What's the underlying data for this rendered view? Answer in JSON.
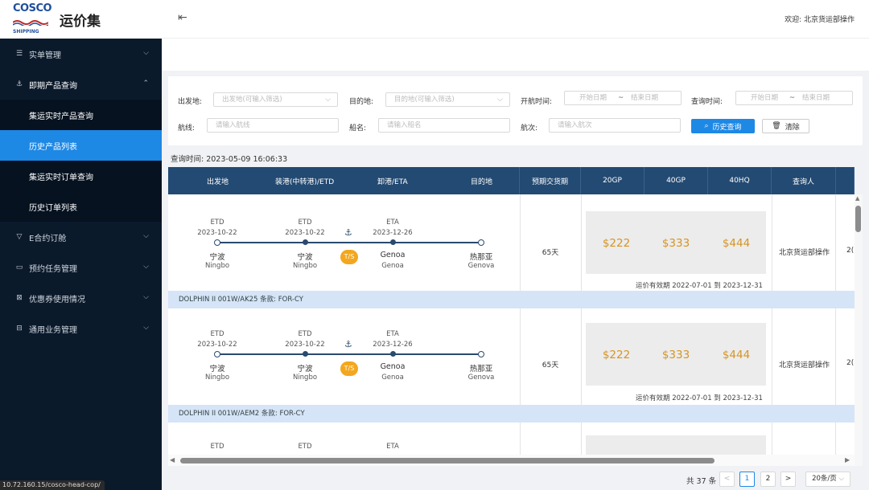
{
  "app": {
    "logo_text": "COSCO",
    "logo_sub": "SHIPPING",
    "title": "运价集",
    "welcome": "欢迎: 北京货运部操作"
  },
  "sidebar": {
    "items": [
      {
        "label": "实单管理",
        "icon": "list-icon"
      },
      {
        "label": "即期产品查询",
        "icon": "ship-icon"
      },
      {
        "label": "E合约订舱",
        "icon": "filter-icon"
      },
      {
        "label": "预约任务管理",
        "icon": "calendar-icon"
      },
      {
        "label": "优惠券使用情况",
        "icon": "coupon-icon"
      },
      {
        "label": "通用业务管理",
        "icon": "settings-icon"
      }
    ],
    "sub_items": [
      "集运实时产品查询",
      "历史产品列表",
      "集运实时订单查询",
      "历史订单列表"
    ]
  },
  "statusbar_url": "10.72.160.15/cosco-head-cop/",
  "filters": {
    "origin_label": "出发地:",
    "origin_ph": "出发地(可输入筛选)",
    "dest_label": "目的地:",
    "dest_ph": "目的地(可输入筛选)",
    "sail_label": "开航时间:",
    "start_ph": "开始日期",
    "sep": "~",
    "end_ph": "结束日期",
    "query_label": "查询时间:",
    "route_label": "航线:",
    "route_ph": "请输入航线",
    "ship_label": "船名:",
    "ship_ph": "请输入船名",
    "voyage_label": "航次:",
    "voyage_ph": "请输入航次",
    "search_btn": "历史查询",
    "clear_btn": "清除"
  },
  "query_time": "查询时间: 2023-05-09 16:06:33",
  "table": {
    "headers": [
      "出发地",
      "装港(中转港)/ETD",
      "卸港/ETA",
      "目的地",
      "预期交货期",
      "20GP",
      "40GP",
      "40HQ",
      "查询人"
    ],
    "rows": [
      {
        "etd_label": "ETD",
        "etd1": "2023-10-22",
        "etd2": "2023-10-22",
        "eta_label": "ETA",
        "eta": "2023-12-26",
        "origin_cn": "宁波",
        "origin_en": "Ningbo",
        "pol_cn": "宁波",
        "pol_en": "Ningbo",
        "ts": "T/S",
        "pod_cn": "Genoa",
        "pod_en": "Genoa",
        "dest_cn": "热那亚",
        "dest_en": "Genova",
        "delivery": "65天",
        "p20gp": "$222",
        "p40gp": "$333",
        "p40hq": "$444",
        "validity": "运价有效期 2022-07-01 到 2023-12-31",
        "user": "北京货运部操作",
        "extra": "2(",
        "band": "DOLPHIN II 001W/AK25 条款: FOR-CY"
      },
      {
        "etd_label": "ETD",
        "etd1": "2023-10-22",
        "etd2": "2023-10-22",
        "eta_label": "ETA",
        "eta": "2023-12-26",
        "origin_cn": "宁波",
        "origin_en": "Ningbo",
        "pol_cn": "宁波",
        "pol_en": "Ningbo",
        "ts": "T/S",
        "pod_cn": "Genoa",
        "pod_en": "Genoa",
        "dest_cn": "热那亚",
        "dest_en": "Genova",
        "delivery": "65天",
        "p20gp": "$222",
        "p40gp": "$333",
        "p40hq": "$444",
        "validity": "运价有效期 2022-07-01 到 2023-12-31",
        "user": "北京货运部操作",
        "extra": "2(",
        "band": "DOLPHIN II 001W/AEM2 条款: FOR-CY"
      },
      {
        "etd_label": "ETD",
        "eta_label": "ETA"
      }
    ]
  },
  "pagination": {
    "total": "共 37 条",
    "prev": "<",
    "pages": [
      "1",
      "2"
    ],
    "next": ">",
    "page_size": "20条/页"
  }
}
